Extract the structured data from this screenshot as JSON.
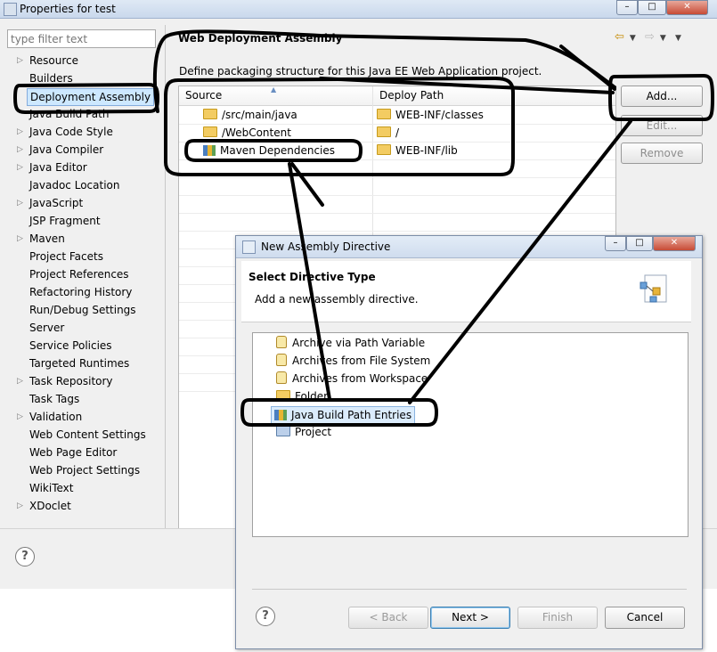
{
  "window": {
    "title": "Properties for test",
    "controls": [
      "–",
      "□",
      "✕"
    ]
  },
  "filter": {
    "placeholder": "type filter text"
  },
  "tree": [
    {
      "label": "Resource",
      "expandable": true
    },
    {
      "label": "Builders",
      "expandable": false
    },
    {
      "label": "Deployment Assembly",
      "expandable": false,
      "selected": true
    },
    {
      "label": "Java Build Path",
      "expandable": false
    },
    {
      "label": "Java Code Style",
      "expandable": true
    },
    {
      "label": "Java Compiler",
      "expandable": true
    },
    {
      "label": "Java Editor",
      "expandable": true
    },
    {
      "label": "Javadoc Location",
      "expandable": false
    },
    {
      "label": "JavaScript",
      "expandable": true
    },
    {
      "label": "JSP Fragment",
      "expandable": false
    },
    {
      "label": "Maven",
      "expandable": true
    },
    {
      "label": "Project Facets",
      "expandable": false
    },
    {
      "label": "Project References",
      "expandable": false
    },
    {
      "label": "Refactoring History",
      "expandable": false
    },
    {
      "label": "Run/Debug Settings",
      "expandable": false
    },
    {
      "label": "Server",
      "expandable": false
    },
    {
      "label": "Service Policies",
      "expandable": false
    },
    {
      "label": "Targeted Runtimes",
      "expandable": false
    },
    {
      "label": "Task Repository",
      "expandable": true
    },
    {
      "label": "Task Tags",
      "expandable": false
    },
    {
      "label": "Validation",
      "expandable": true
    },
    {
      "label": "Web Content Settings",
      "expandable": false
    },
    {
      "label": "Web Page Editor",
      "expandable": false
    },
    {
      "label": "Web Project Settings",
      "expandable": false
    },
    {
      "label": "WikiText",
      "expandable": false
    },
    {
      "label": "XDoclet",
      "expandable": true
    }
  ],
  "panel": {
    "title": "Web Deployment Assembly",
    "description": "Define packaging structure for this Java EE Web Application project.",
    "columns": [
      "Source",
      "Deploy Path"
    ],
    "rows": [
      {
        "source": "/src/main/java",
        "deploy": "WEB-INF/classes",
        "icon": "folder-icon"
      },
      {
        "source": "/WebContent",
        "deploy": "/",
        "icon": "folder-icon"
      },
      {
        "source": "Maven Dependencies",
        "deploy": "WEB-INF/lib",
        "icon": "library-icon"
      }
    ],
    "buttons": {
      "add": "Add...",
      "edit": "Edit...",
      "remove": "Remove"
    }
  },
  "help_glyph": "?",
  "dialog": {
    "title": "New Assembly Directive",
    "controls": [
      "–",
      "□",
      "✕"
    ],
    "heading": "Select Directive Type",
    "subheading": "Add a new assembly directive.",
    "items": [
      {
        "label": "Archive via Path Variable",
        "icon": "jar-icon"
      },
      {
        "label": "Archives from File System",
        "icon": "jar-icon"
      },
      {
        "label": "Archives from Workspace",
        "icon": "jar-icon"
      },
      {
        "label": "Folder",
        "icon": "folder-icon"
      },
      {
        "label": "Java Build Path Entries",
        "icon": "library-icon",
        "selected": true
      },
      {
        "label": "Project",
        "icon": "project-icon"
      }
    ],
    "buttons": {
      "back": "< Back",
      "next": "Next >",
      "finish": "Finish",
      "cancel": "Cancel"
    }
  }
}
